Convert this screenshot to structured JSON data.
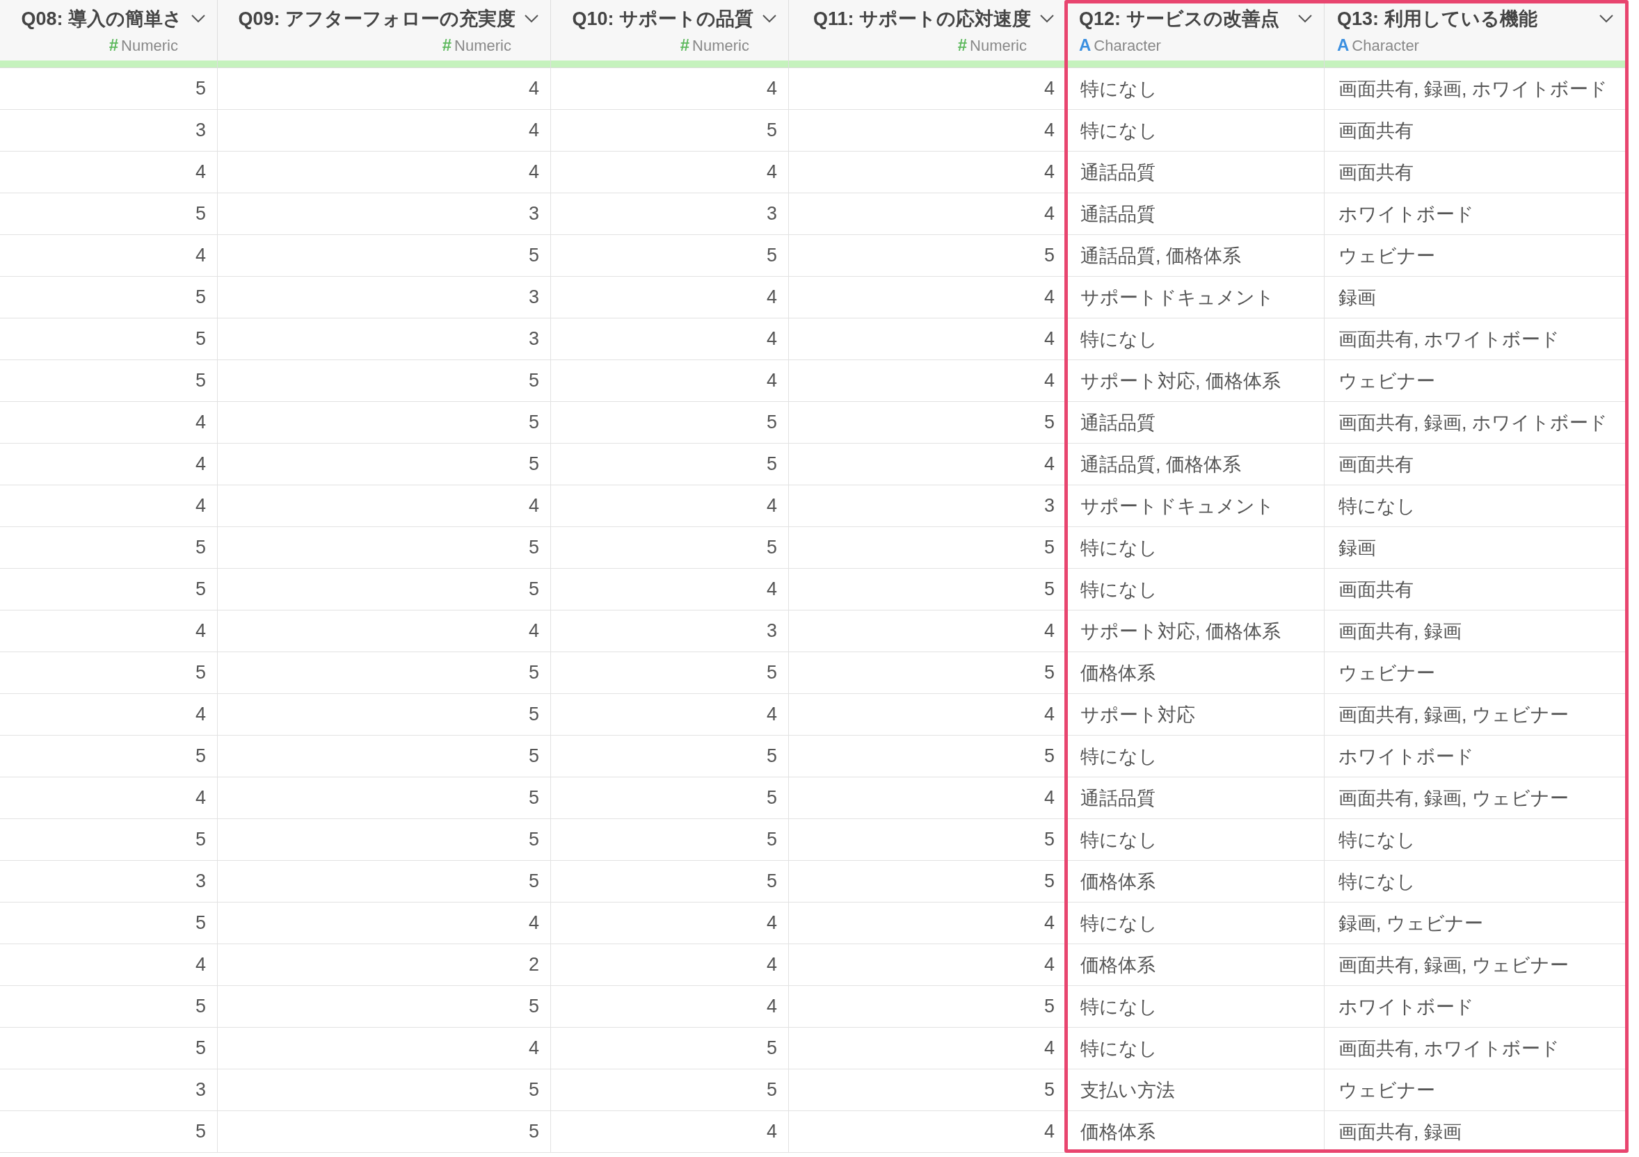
{
  "columns": [
    {
      "name": "Q08: 導入の簡単さ",
      "type_mark": "#",
      "type": "Numeric",
      "kind": "numeric",
      "selected": false
    },
    {
      "name": "Q09: アフターフォローの充実度",
      "type_mark": "#",
      "type": "Numeric",
      "kind": "numeric",
      "selected": false
    },
    {
      "name": "Q10: サポートの品質",
      "type_mark": "#",
      "type": "Numeric",
      "kind": "numeric",
      "selected": false
    },
    {
      "name": "Q11: サポートの応対速度",
      "type_mark": "#",
      "type": "Numeric",
      "kind": "numeric",
      "selected": false
    },
    {
      "name": "Q12: サービスの改善点",
      "type_mark": "A",
      "type": "Character",
      "kind": "character",
      "selected": true
    },
    {
      "name": "Q13: 利用している機能",
      "type_mark": "A",
      "type": "Character",
      "kind": "character",
      "selected": true
    }
  ],
  "rows": [
    [
      "5",
      "4",
      "4",
      "4",
      "特になし",
      "画面共有, 録画, ホワイトボード"
    ],
    [
      "3",
      "4",
      "5",
      "4",
      "特になし",
      "画面共有"
    ],
    [
      "4",
      "4",
      "4",
      "4",
      "通話品質",
      "画面共有"
    ],
    [
      "5",
      "3",
      "3",
      "4",
      "通話品質",
      "ホワイトボード"
    ],
    [
      "4",
      "5",
      "5",
      "5",
      "通話品質, 価格体系",
      "ウェビナー"
    ],
    [
      "5",
      "3",
      "4",
      "4",
      "サポートドキュメント",
      "録画"
    ],
    [
      "5",
      "3",
      "4",
      "4",
      "特になし",
      "画面共有, ホワイトボード"
    ],
    [
      "5",
      "5",
      "4",
      "4",
      "サポート対応, 価格体系",
      "ウェビナー"
    ],
    [
      "4",
      "5",
      "5",
      "5",
      "通話品質",
      "画面共有, 録画, ホワイトボード"
    ],
    [
      "4",
      "5",
      "5",
      "4",
      "通話品質, 価格体系",
      "画面共有"
    ],
    [
      "4",
      "4",
      "4",
      "3",
      "サポートドキュメント",
      "特になし"
    ],
    [
      "5",
      "5",
      "5",
      "5",
      "特になし",
      "録画"
    ],
    [
      "5",
      "5",
      "4",
      "5",
      "特になし",
      "画面共有"
    ],
    [
      "4",
      "4",
      "3",
      "4",
      "サポート対応, 価格体系",
      "画面共有, 録画"
    ],
    [
      "5",
      "5",
      "5",
      "5",
      "価格体系",
      "ウェビナー"
    ],
    [
      "4",
      "5",
      "4",
      "4",
      "サポート対応",
      "画面共有, 録画, ウェビナー"
    ],
    [
      "5",
      "5",
      "5",
      "5",
      "特になし",
      "ホワイトボード"
    ],
    [
      "4",
      "5",
      "5",
      "4",
      "通話品質",
      "画面共有, 録画, ウェビナー"
    ],
    [
      "5",
      "5",
      "5",
      "5",
      "特になし",
      "特になし"
    ],
    [
      "3",
      "5",
      "5",
      "5",
      "価格体系",
      "特になし"
    ],
    [
      "5",
      "4",
      "4",
      "4",
      "特になし",
      "録画, ウェビナー"
    ],
    [
      "4",
      "2",
      "4",
      "4",
      "価格体系",
      "画面共有, 録画, ウェビナー"
    ],
    [
      "5",
      "5",
      "4",
      "5",
      "特になし",
      "ホワイトボード"
    ],
    [
      "5",
      "4",
      "5",
      "4",
      "特になし",
      "画面共有, ホワイトボード"
    ],
    [
      "3",
      "5",
      "5",
      "5",
      "支払い方法",
      "ウェビナー"
    ],
    [
      "5",
      "5",
      "4",
      "4",
      "価格体系",
      "画面共有, 録画"
    ]
  ]
}
